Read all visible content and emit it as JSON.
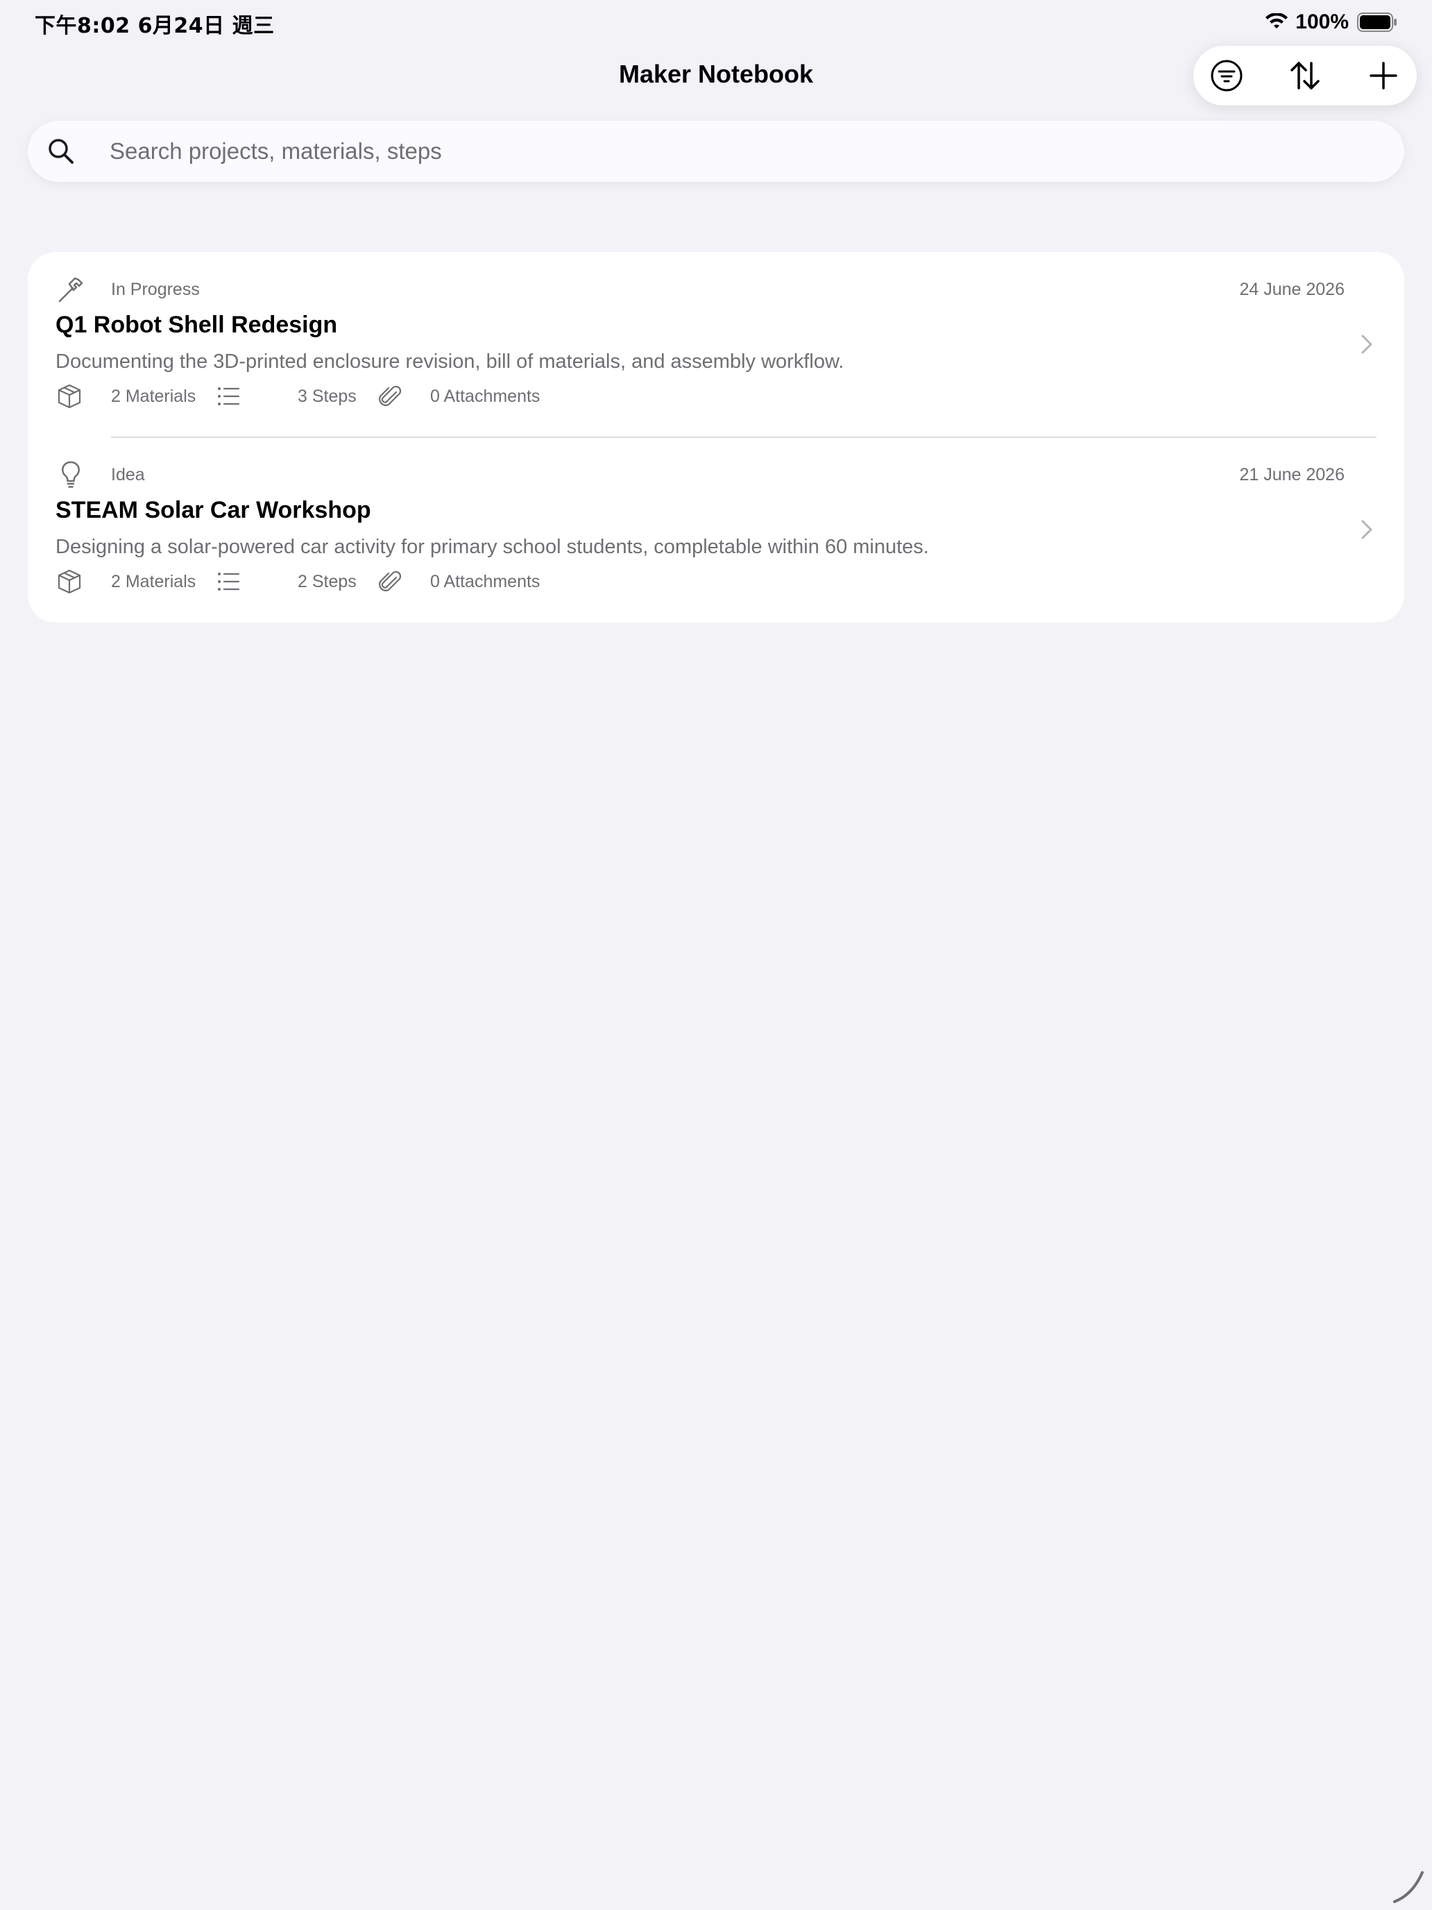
{
  "status_bar": {
    "time": "下午8:02   6月24日 週三",
    "battery": "100%"
  },
  "header": {
    "title": "Maker Notebook"
  },
  "toolbar": {
    "icons": [
      "filter-icon",
      "sort-icon",
      "add-icon"
    ]
  },
  "search": {
    "placeholder": "Search projects, materials, steps",
    "value": ""
  },
  "projects": [
    {
      "status": "In Progress",
      "status_icon": "hammer-icon",
      "date": "24 June 2026",
      "title": "Q1 Robot Shell Redesign",
      "description": "Documenting the 3D-printed enclosure revision, bill of materials, and assembly workflow.",
      "materials": "2 Materials",
      "steps": "3 Steps",
      "attachments": "0 Attachments"
    },
    {
      "status": "Idea",
      "status_icon": "lightbulb-icon",
      "date": "21 June 2026",
      "title": "STEAM Solar Car Workshop",
      "description": "Designing a solar-powered car activity for primary school students, completable within 60 minutes.",
      "materials": "2 Materials",
      "steps": "2 Steps",
      "attachments": "0 Attachments"
    }
  ],
  "colors": {
    "background": "#f2f2f7",
    "card": "#ffffff",
    "secondary_text": "#6e6e73"
  }
}
